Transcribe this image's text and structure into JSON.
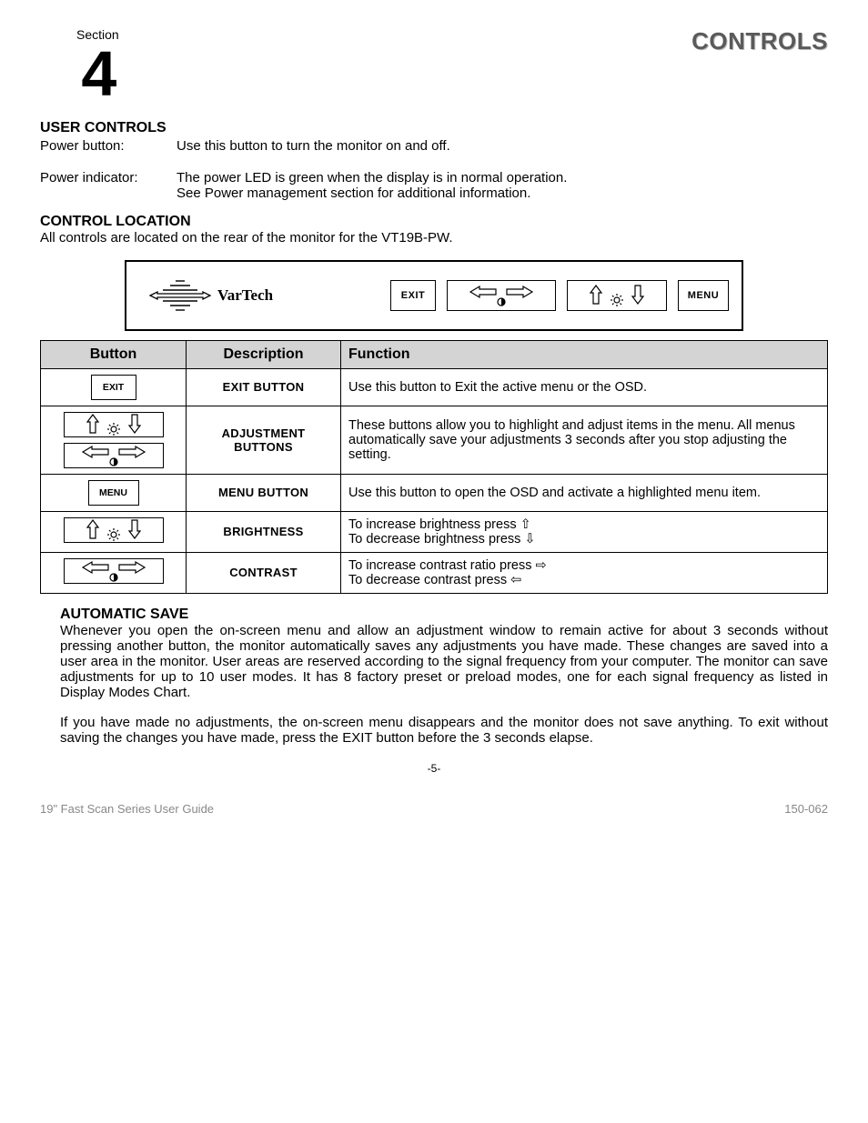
{
  "section": {
    "label": "Section",
    "number": "4"
  },
  "title": "CONTROLS",
  "user_controls": {
    "heading": "USER CONTROLS",
    "power_button_label": "Power button:",
    "power_button_text": "Use this button to turn the monitor on and off.",
    "power_indicator_label": "Power indicator:",
    "power_indicator_text1": "The power LED is green when the display is in normal operation.",
    "power_indicator_text2": "See Power management section for additional information."
  },
  "control_location": {
    "heading": "CONTROL LOCATION",
    "text": "All controls are located on the rear of the monitor for the VT19B-PW."
  },
  "panel": {
    "brand": "VarTech",
    "exit": "EXIT",
    "menu": "MENU"
  },
  "table": {
    "headers": {
      "button": "Button",
      "description": "Description",
      "function": "Function"
    },
    "rows": [
      {
        "btn_kind": "exit",
        "desc": "EXIT BUTTON",
        "func": "Use this button to Exit the active menu or the OSD."
      },
      {
        "btn_kind": "adjust",
        "desc": "ADJUSTMENT BUTTONS",
        "func": "These buttons allow you to highlight and adjust items in the menu. All menus automatically save your adjustments 3 seconds after you stop adjusting the setting."
      },
      {
        "btn_kind": "menu",
        "desc": "MENU BUTTON",
        "func": "Use this button to open the OSD and activate a highlighted menu item."
      },
      {
        "btn_kind": "brightness",
        "desc": "BRIGHTNESS",
        "func_line1": "To increase brightness press ⇧",
        "func_line2": "To decrease brightness press ⇩"
      },
      {
        "btn_kind": "contrast",
        "desc": "CONTRAST",
        "func_line1": "To increase contrast ratio press ⇨",
        "func_line2": "To decrease contrast press ⇦"
      }
    ]
  },
  "auto_save": {
    "heading": "AUTOMATIC SAVE",
    "p1": "Whenever you open the on-screen menu and allow an adjustment window to remain active for about 3 seconds without pressing another button, the monitor automatically saves any adjustments you have made. These changes are saved into a user area in the monitor. User areas are reserved according to the signal frequency from your computer. The monitor can save adjustments for up to 10 user modes. It has 8 factory preset or preload modes, one for each signal frequency as listed in Display Modes Chart.",
    "p2": "If you have made no adjustments, the on-screen menu disappears and the monitor does not save anything. To exit without saving the changes you have made, press the EXIT button before the 3 seconds elapse."
  },
  "page_number": "-5-",
  "footer": {
    "left": "19\" Fast Scan Series User Guide",
    "right": "150-062"
  }
}
